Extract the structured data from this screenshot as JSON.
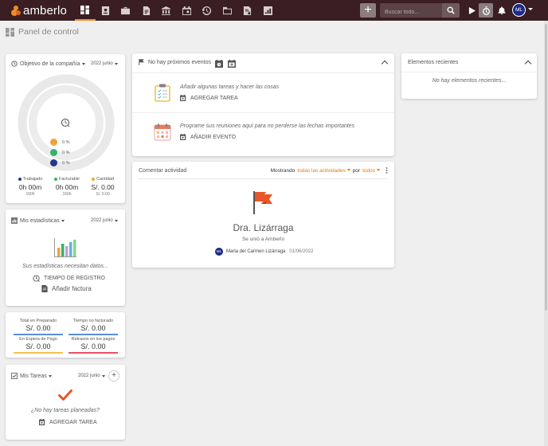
{
  "app": {
    "logo_text": "amberlo"
  },
  "topbar": {
    "nav_icons": [
      "dashboard-icon",
      "contacts-icon",
      "briefcase-icon",
      "document-icon",
      "bank-icon",
      "calendar-icon",
      "history-icon",
      "folder-icon",
      "invoice-icon",
      "report-icon"
    ],
    "plus_label": "+",
    "search_placeholder": "Buscar todo...",
    "avatar_initials": "ML"
  },
  "page": {
    "title": "Panel de control"
  },
  "goal_card": {
    "title": "Objetivo de la compañía",
    "period": "2022 junio",
    "rings": [
      {
        "color": "#f2a23a",
        "value": "0 %"
      },
      {
        "color": "#34b26b",
        "value": "0 %"
      },
      {
        "color": "#233a8a",
        "value": "0 %"
      }
    ],
    "stats": [
      {
        "label": "Trabajado",
        "color": "#233a8a",
        "value": "0h 00m",
        "sub": "160h"
      },
      {
        "label": "Facturable",
        "color": "#34b26b",
        "value": "0h 00m",
        "sub": "160h"
      },
      {
        "label": "Cantidad",
        "color": "#f2a23a",
        "value": "S/. 0.00",
        "sub": "S/. 0.00"
      }
    ]
  },
  "stats_card": {
    "title": "Mis estadísticas",
    "period": "2022 junio",
    "message": "Sus estadísticas necesitan datos...",
    "action1": "TIEMPO DE REGISTRO",
    "action2": "Añadir factura",
    "bar_colors": [
      "#f2a23a",
      "#34b26b",
      "#5bb5e0",
      "#c9a0dc",
      "#8fd18f"
    ]
  },
  "finance_card": {
    "items": [
      {
        "label": "Total en Preparado",
        "value": "S/. 0.00",
        "color": "#5b8ed6"
      },
      {
        "label": "Tiempo no facturado",
        "value": "S/. 0.00",
        "color": "#5b8ed6"
      },
      {
        "label": "En Espera de Pago",
        "value": "S/. 0.00",
        "color": "#f2c14e"
      },
      {
        "label": "Retrasos en los pagos",
        "value": "S/. 0.00",
        "color": "#e8506a"
      }
    ]
  },
  "tasks_card": {
    "title": "Mis Tareas",
    "period": "2022 junio",
    "add_label": "+",
    "message": "¿No hay tareas planeadas?",
    "action": "AGREGAR TAREA"
  },
  "events_card": {
    "title": "No hay próximos eventos",
    "items": [
      {
        "text": "Añadir algunas tareas y hacer las cosas",
        "action": "AGREGAR TAREA"
      },
      {
        "text": "Programe sus reuniones aquí para no perderse las fechas importantes",
        "action": "AÑADIR EVENTO"
      }
    ]
  },
  "activity_card": {
    "title": "Comentar actividad",
    "showing_prefix": "Mostrando",
    "filter_activity": "todas las actividades",
    "by_label": "por",
    "filter_user": "todos",
    "entry_title": "Dra. Lizárraga",
    "entry_sub": "Se unió a Amberlo",
    "user_initials": "ML",
    "user_name": "Maria del Carmen Lizárraga",
    "date": "01/06/2022"
  },
  "recent_card": {
    "title": "Elementos recientes",
    "empty": "No hay elementos recientes..."
  },
  "colors": {
    "topbar": "#3a1e23",
    "accent": "#f28c28",
    "link": "#e07b1a"
  }
}
